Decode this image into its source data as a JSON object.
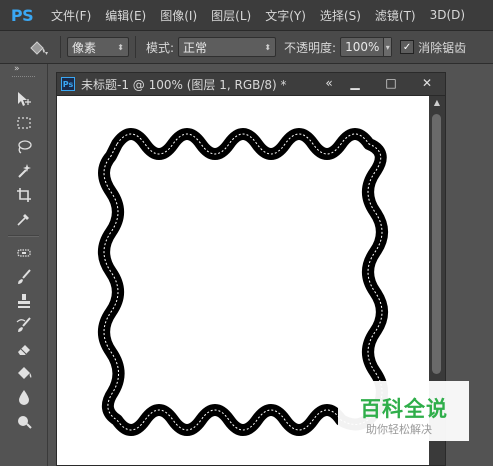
{
  "app": {
    "logo": "PS"
  },
  "menu": [
    "文件(F)",
    "编辑(E)",
    "图像(I)",
    "图层(L)",
    "文字(Y)",
    "选择(S)",
    "滤镜(T)",
    "3D(D)"
  ],
  "options": {
    "sample_select": "像素",
    "mode_label": "模式:",
    "mode_value": "正常",
    "opacity_label": "不透明度:",
    "opacity_value": "100%",
    "antialias_label": "消除锯齿"
  },
  "tools": [
    "move-tool",
    "marquee-tool",
    "lasso-tool",
    "quick-selection-tool",
    "crop-tool",
    "eyedropper-tool",
    "healing-brush-tool",
    "brush-tool",
    "clone-stamp-tool",
    "history-brush-tool",
    "eraser-tool",
    "paint-bucket-tool",
    "blur-tool",
    "dodge-tool"
  ],
  "document": {
    "title": "未标题-1 @ 100% (图层 1, RGB/8) *",
    "buttons": {
      "collapse": "«",
      "minimize": "▁",
      "maximize": "□",
      "close": "✕"
    }
  },
  "watermark": {
    "main": "百科全说",
    "sub": "助你轻松解决"
  },
  "colors": {
    "ps_blue": "#3aa7f3",
    "watermark_green": "#2fae4a",
    "ui_dark": "#3c3c3c"
  }
}
